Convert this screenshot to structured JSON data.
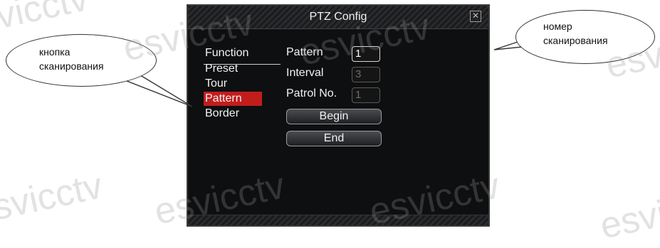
{
  "watermark": "esvicctv",
  "dialog": {
    "title": "PTZ Config",
    "close_glyph": "✕",
    "menu_items": [
      {
        "label": "Function",
        "selected": false
      },
      {
        "label": "Preset",
        "selected": false
      },
      {
        "label": "Tour",
        "selected": false
      },
      {
        "label": "Pattern",
        "selected": true
      },
      {
        "label": "Border",
        "selected": false
      }
    ],
    "fields": {
      "pattern": {
        "label": "Pattern",
        "value": "1"
      },
      "interval": {
        "label": "Interval",
        "value": "3"
      },
      "patrol_no": {
        "label": "Patrol No.",
        "value": "1"
      }
    },
    "buttons": {
      "begin": "Begin",
      "end": "End"
    }
  },
  "callouts": {
    "left": {
      "line1": "кнопка",
      "line2": "сканирования"
    },
    "right": {
      "line1": "номер",
      "line2": "сканирования"
    }
  },
  "colors": {
    "selected_bg": "#c21d1d",
    "dialog_bg": "#0e0f10"
  }
}
